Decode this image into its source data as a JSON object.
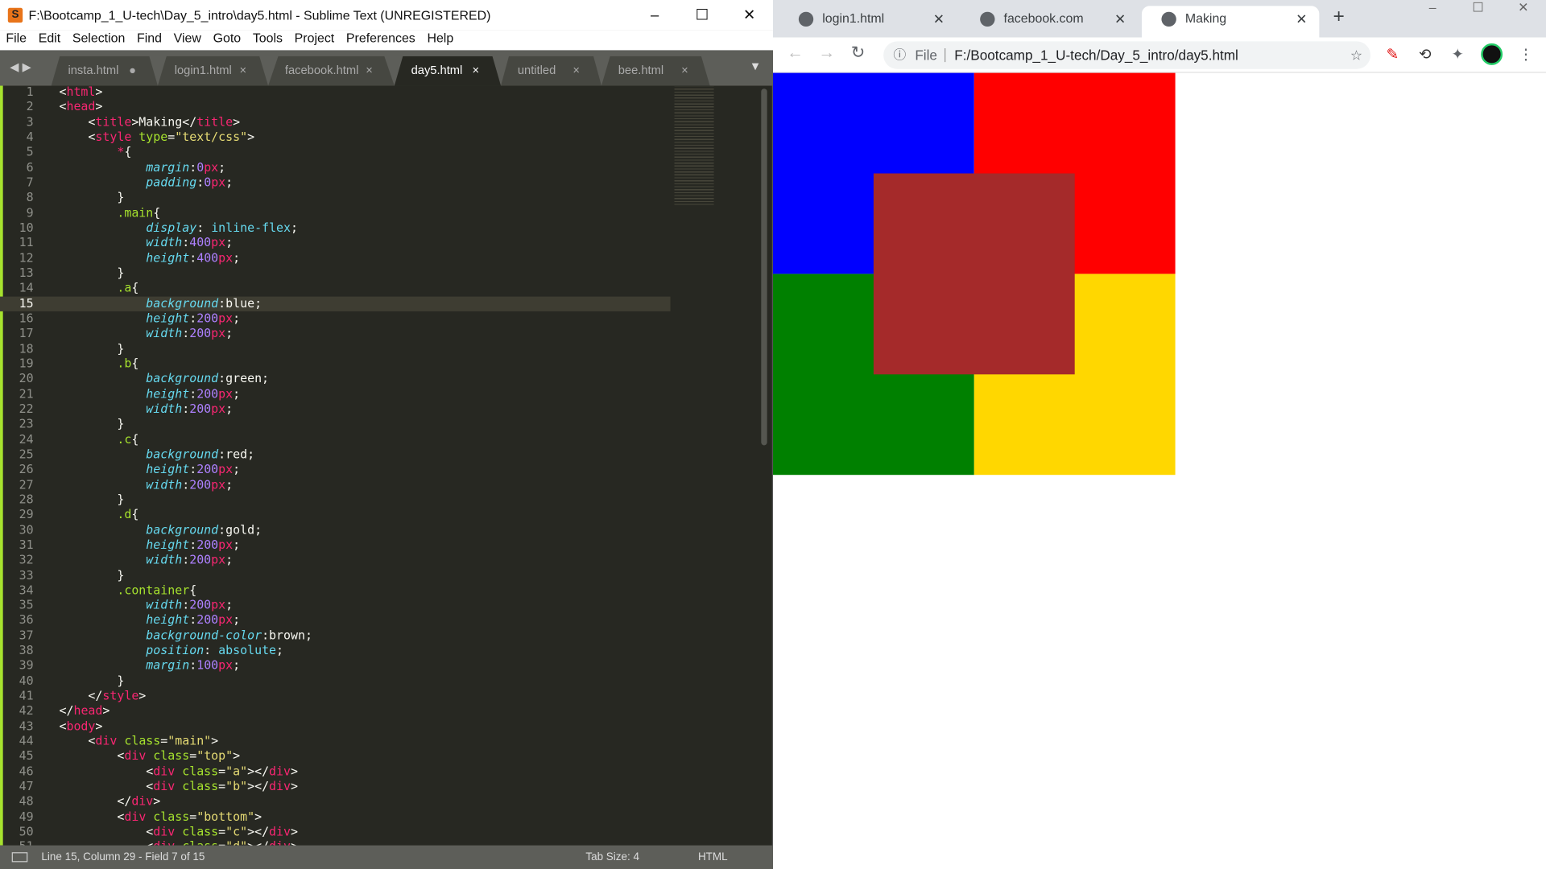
{
  "sublime": {
    "title": "F:\\Bootcamp_1_U-tech\\Day_5_intro\\day5.html - Sublime Text (UNREGISTERED)",
    "menu": [
      "File",
      "Edit",
      "Selection",
      "Find",
      "View",
      "Goto",
      "Tools",
      "Project",
      "Preferences",
      "Help"
    ],
    "tabs": [
      {
        "label": "insta.html",
        "mark": "●"
      },
      {
        "label": "login1.html",
        "mark": "×"
      },
      {
        "label": "facebook.html",
        "mark": "×"
      },
      {
        "label": "day5.html",
        "mark": "×",
        "active": true
      },
      {
        "label": "untitled",
        "mark": "×"
      },
      {
        "label": "bee.html",
        "mark": "×"
      }
    ],
    "current_line": 15,
    "lines": [
      [
        [
          "p",
          "<"
        ],
        [
          "tag",
          "html"
        ],
        [
          "p",
          ">"
        ]
      ],
      [
        [
          "p",
          "<"
        ],
        [
          "tag",
          "head"
        ],
        [
          "p",
          ">"
        ]
      ],
      [
        [
          "p",
          "    <"
        ],
        [
          "tag",
          "title"
        ],
        [
          "p",
          ">Making</"
        ],
        [
          "tag",
          "title"
        ],
        [
          "p",
          ">"
        ]
      ],
      [
        [
          "p",
          "    <"
        ],
        [
          "tag",
          "style"
        ],
        [
          "p",
          " "
        ],
        [
          "attr",
          "type"
        ],
        [
          "p",
          "="
        ],
        [
          "str",
          "\"text/css\""
        ],
        [
          "p",
          ">"
        ]
      ],
      [
        [
          "p",
          "        "
        ],
        [
          "tag",
          "*"
        ],
        [
          "p",
          "{"
        ]
      ],
      [
        [
          "p",
          "            "
        ],
        [
          "prop",
          "margin"
        ],
        [
          "p",
          ":"
        ],
        [
          "num",
          "0"
        ],
        [
          "unit",
          "px"
        ],
        [
          "p",
          ";"
        ]
      ],
      [
        [
          "p",
          "            "
        ],
        [
          "prop",
          "padding"
        ],
        [
          "p",
          ":"
        ],
        [
          "num",
          "0"
        ],
        [
          "unit",
          "px"
        ],
        [
          "p",
          ";"
        ]
      ],
      [
        [
          "p",
          "        }"
        ]
      ],
      [
        [
          "p",
          "        "
        ],
        [
          "sel",
          ".main"
        ],
        [
          "p",
          "{"
        ]
      ],
      [
        [
          "p",
          "            "
        ],
        [
          "prop",
          "display"
        ],
        [
          "p",
          ": "
        ],
        [
          "kw",
          "inline-flex"
        ],
        [
          "p",
          ";"
        ]
      ],
      [
        [
          "p",
          "            "
        ],
        [
          "prop",
          "width"
        ],
        [
          "p",
          ":"
        ],
        [
          "num",
          "400"
        ],
        [
          "unit",
          "px"
        ],
        [
          "p",
          ";"
        ]
      ],
      [
        [
          "p",
          "            "
        ],
        [
          "prop",
          "height"
        ],
        [
          "p",
          ":"
        ],
        [
          "num",
          "400"
        ],
        [
          "unit",
          "px"
        ],
        [
          "p",
          ";"
        ]
      ],
      [
        [
          "p",
          "        }"
        ]
      ],
      [
        [
          "p",
          "        "
        ],
        [
          "sel",
          ".a"
        ],
        [
          "p",
          "{"
        ]
      ],
      [
        [
          "p",
          "            "
        ],
        [
          "prop",
          "background"
        ],
        [
          "p",
          ":blue;"
        ]
      ],
      [
        [
          "p",
          "            "
        ],
        [
          "prop",
          "height"
        ],
        [
          "p",
          ":"
        ],
        [
          "num",
          "200"
        ],
        [
          "unit",
          "px"
        ],
        [
          "p",
          ";"
        ]
      ],
      [
        [
          "p",
          "            "
        ],
        [
          "prop",
          "width"
        ],
        [
          "p",
          ":"
        ],
        [
          "num",
          "200"
        ],
        [
          "unit",
          "px"
        ],
        [
          "p",
          ";"
        ]
      ],
      [
        [
          "p",
          "        }"
        ]
      ],
      [
        [
          "p",
          "        "
        ],
        [
          "sel",
          ".b"
        ],
        [
          "p",
          "{"
        ]
      ],
      [
        [
          "p",
          "            "
        ],
        [
          "prop",
          "background"
        ],
        [
          "p",
          ":green;"
        ]
      ],
      [
        [
          "p",
          "            "
        ],
        [
          "prop",
          "height"
        ],
        [
          "p",
          ":"
        ],
        [
          "num",
          "200"
        ],
        [
          "unit",
          "px"
        ],
        [
          "p",
          ";"
        ]
      ],
      [
        [
          "p",
          "            "
        ],
        [
          "prop",
          "width"
        ],
        [
          "p",
          ":"
        ],
        [
          "num",
          "200"
        ],
        [
          "unit",
          "px"
        ],
        [
          "p",
          ";"
        ]
      ],
      [
        [
          "p",
          "        }"
        ]
      ],
      [
        [
          "p",
          "        "
        ],
        [
          "sel",
          ".c"
        ],
        [
          "p",
          "{"
        ]
      ],
      [
        [
          "p",
          "            "
        ],
        [
          "prop",
          "background"
        ],
        [
          "p",
          ":red;"
        ]
      ],
      [
        [
          "p",
          "            "
        ],
        [
          "prop",
          "height"
        ],
        [
          "p",
          ":"
        ],
        [
          "num",
          "200"
        ],
        [
          "unit",
          "px"
        ],
        [
          "p",
          ";"
        ]
      ],
      [
        [
          "p",
          "            "
        ],
        [
          "prop",
          "width"
        ],
        [
          "p",
          ":"
        ],
        [
          "num",
          "200"
        ],
        [
          "unit",
          "px"
        ],
        [
          "p",
          ";"
        ]
      ],
      [
        [
          "p",
          "        }"
        ]
      ],
      [
        [
          "p",
          "        "
        ],
        [
          "sel",
          ".d"
        ],
        [
          "p",
          "{"
        ]
      ],
      [
        [
          "p",
          "            "
        ],
        [
          "prop",
          "background"
        ],
        [
          "p",
          ":gold;"
        ]
      ],
      [
        [
          "p",
          "            "
        ],
        [
          "prop",
          "height"
        ],
        [
          "p",
          ":"
        ],
        [
          "num",
          "200"
        ],
        [
          "unit",
          "px"
        ],
        [
          "p",
          ";"
        ]
      ],
      [
        [
          "p",
          "            "
        ],
        [
          "prop",
          "width"
        ],
        [
          "p",
          ":"
        ],
        [
          "num",
          "200"
        ],
        [
          "unit",
          "px"
        ],
        [
          "p",
          ";"
        ]
      ],
      [
        [
          "p",
          "        }"
        ]
      ],
      [
        [
          "p",
          "        "
        ],
        [
          "sel",
          ".container"
        ],
        [
          "p",
          "{"
        ]
      ],
      [
        [
          "p",
          "            "
        ],
        [
          "prop",
          "width"
        ],
        [
          "p",
          ":"
        ],
        [
          "num",
          "200"
        ],
        [
          "unit",
          "px"
        ],
        [
          "p",
          ";"
        ]
      ],
      [
        [
          "p",
          "            "
        ],
        [
          "prop",
          "height"
        ],
        [
          "p",
          ":"
        ],
        [
          "num",
          "200"
        ],
        [
          "unit",
          "px"
        ],
        [
          "p",
          ";"
        ]
      ],
      [
        [
          "p",
          "            "
        ],
        [
          "prop",
          "background-color"
        ],
        [
          "p",
          ":brown;"
        ]
      ],
      [
        [
          "p",
          "            "
        ],
        [
          "prop",
          "position"
        ],
        [
          "p",
          ": "
        ],
        [
          "kw",
          "absolute"
        ],
        [
          "p",
          ";"
        ]
      ],
      [
        [
          "p",
          "            "
        ],
        [
          "prop",
          "margin"
        ],
        [
          "p",
          ":"
        ],
        [
          "num",
          "100"
        ],
        [
          "unit",
          "px"
        ],
        [
          "p",
          ";"
        ]
      ],
      [
        [
          "p",
          "        }"
        ]
      ],
      [
        [
          "p",
          "    </"
        ],
        [
          "tag",
          "style"
        ],
        [
          "p",
          ">"
        ]
      ],
      [
        [
          "p",
          "</"
        ],
        [
          "tag",
          "head"
        ],
        [
          "p",
          ">"
        ]
      ],
      [
        [
          "p",
          "<"
        ],
        [
          "tag",
          "body"
        ],
        [
          "p",
          ">"
        ]
      ],
      [
        [
          "p",
          "    <"
        ],
        [
          "tag",
          "div"
        ],
        [
          "p",
          " "
        ],
        [
          "attr",
          "class"
        ],
        [
          "p",
          "="
        ],
        [
          "str",
          "\"main\""
        ],
        [
          "p",
          ">"
        ]
      ],
      [
        [
          "p",
          "        <"
        ],
        [
          "tag",
          "div"
        ],
        [
          "p",
          " "
        ],
        [
          "attr",
          "class"
        ],
        [
          "p",
          "="
        ],
        [
          "str",
          "\"top\""
        ],
        [
          "p",
          ">"
        ]
      ],
      [
        [
          "p",
          "            <"
        ],
        [
          "tag",
          "div"
        ],
        [
          "p",
          " "
        ],
        [
          "attr",
          "class"
        ],
        [
          "p",
          "="
        ],
        [
          "str",
          "\"a\""
        ],
        [
          "p",
          "></"
        ],
        [
          "tag",
          "div"
        ],
        [
          "p",
          ">"
        ]
      ],
      [
        [
          "p",
          "            <"
        ],
        [
          "tag",
          "div"
        ],
        [
          "p",
          " "
        ],
        [
          "attr",
          "class"
        ],
        [
          "p",
          "="
        ],
        [
          "str",
          "\"b\""
        ],
        [
          "p",
          "></"
        ],
        [
          "tag",
          "div"
        ],
        [
          "p",
          ">"
        ]
      ],
      [
        [
          "p",
          "        </"
        ],
        [
          "tag",
          "div"
        ],
        [
          "p",
          ">"
        ]
      ],
      [
        [
          "p",
          "        <"
        ],
        [
          "tag",
          "div"
        ],
        [
          "p",
          " "
        ],
        [
          "attr",
          "class"
        ],
        [
          "p",
          "="
        ],
        [
          "str",
          "\"bottom\""
        ],
        [
          "p",
          ">"
        ]
      ],
      [
        [
          "p",
          "            <"
        ],
        [
          "tag",
          "div"
        ],
        [
          "p",
          " "
        ],
        [
          "attr",
          "class"
        ],
        [
          "p",
          "="
        ],
        [
          "str",
          "\"c\""
        ],
        [
          "p",
          "></"
        ],
        [
          "tag",
          "div"
        ],
        [
          "p",
          ">"
        ]
      ],
      [
        [
          "p",
          "            <"
        ],
        [
          "tag",
          "div"
        ],
        [
          "p",
          " "
        ],
        [
          "attr",
          "class"
        ],
        [
          "p",
          "="
        ],
        [
          "str",
          "\"d\""
        ],
        [
          "p",
          "></"
        ],
        [
          "tag",
          "div"
        ],
        [
          "p",
          ">"
        ]
      ]
    ],
    "status": {
      "position": "Line 15, Column 29 - Field 7 of 15",
      "tab_size": "Tab Size: 4",
      "syntax": "HTML"
    }
  },
  "chrome": {
    "tabs": [
      {
        "label": "login1.html"
      },
      {
        "label": "facebook.com"
      },
      {
        "label": "Making",
        "active": true
      }
    ],
    "new_tab": "+",
    "omnibox": {
      "scheme_label": "File",
      "url": "F:/Bootcamp_1_U-tech/Day_5_intro/day5.html"
    },
    "page_colors": {
      "a": "#0000ff",
      "b": "#008000",
      "c": "#ff0000",
      "d": "#ffd700",
      "container": "#a52a2a"
    }
  }
}
